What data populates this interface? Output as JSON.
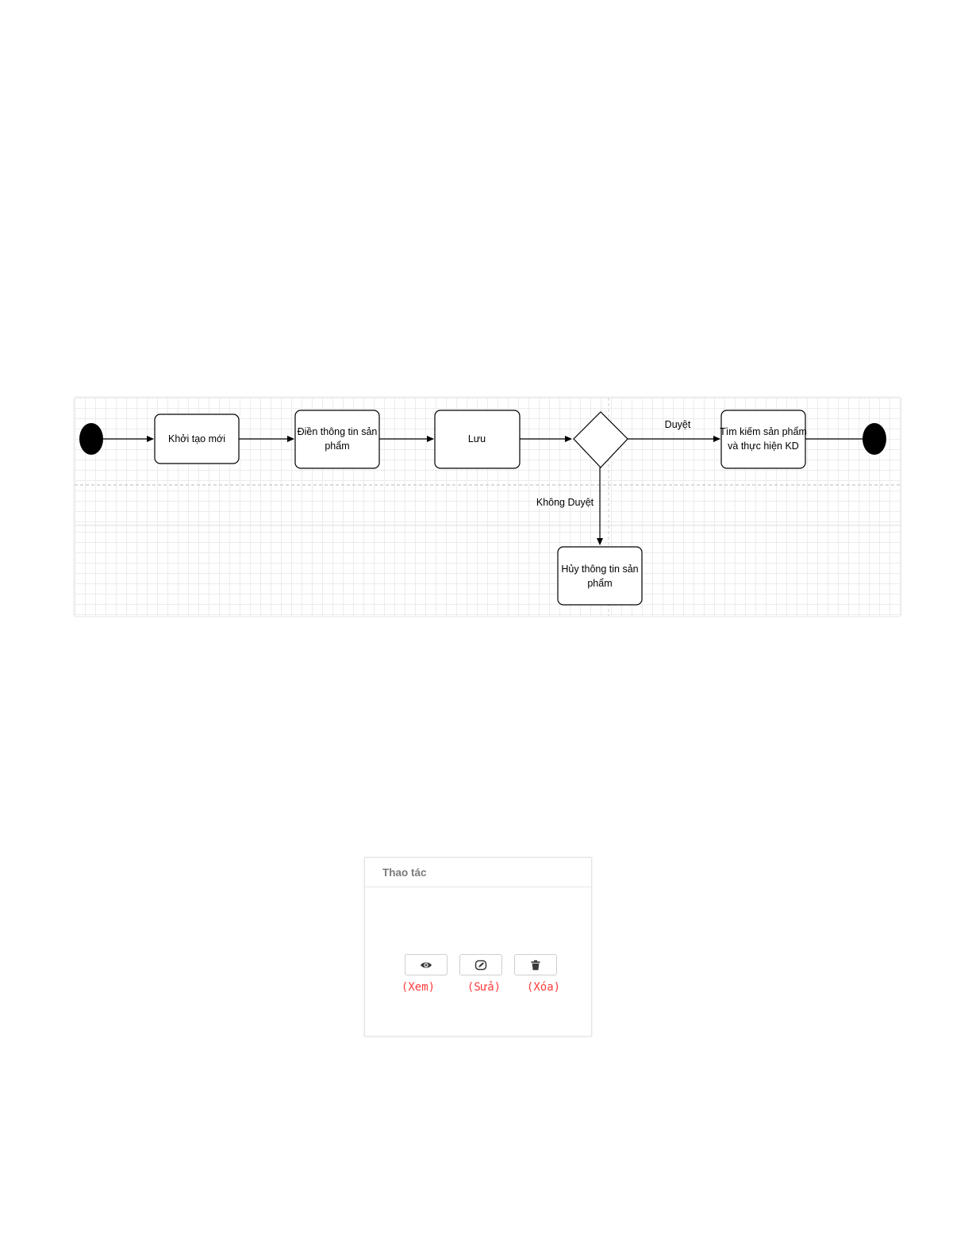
{
  "diagram": {
    "nodes": {
      "create": "Khởi tạo mới",
      "fill_line1": "Điền thông tin sản",
      "fill_line2": "phẩm",
      "save": "Lưu",
      "search_line1": "Tìm kiếm sản phẩm",
      "search_line2": "và thực hiện KD",
      "cancel_line1": "Hủy thông tin sản",
      "cancel_line2": "phẩm"
    },
    "edges": {
      "approved": "Duyệt",
      "rejected": "Không Duyệt"
    }
  },
  "actions": {
    "header": "Thao tác",
    "buttons": [
      {
        "label": "(Xem)",
        "icon": "eye-icon"
      },
      {
        "label": "(Sửa)",
        "icon": "pencil-icon"
      },
      {
        "label": "(Xóa)",
        "icon": "trash-icon"
      }
    ],
    "label_color": "#ff3b3b"
  }
}
